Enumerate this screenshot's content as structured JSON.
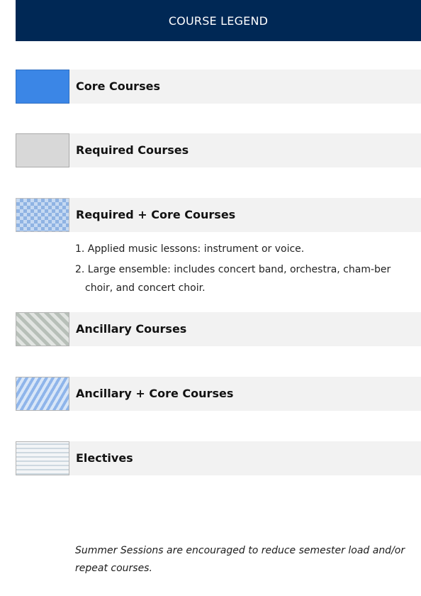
{
  "header": {
    "title": "COURSE LEGEND"
  },
  "legend": [
    {
      "label": "Core Courses",
      "pattern": "solid-blue",
      "color": "#3b86e6"
    },
    {
      "label": "Required Courses",
      "pattern": "solid-gray",
      "color": "#d8d8d8"
    },
    {
      "label": "Required + Core Courses",
      "pattern": "blue-checker",
      "color": "#8fb3e3"
    },
    {
      "label": "Ancillary Courses",
      "pattern": "gray-diagonal-stripes",
      "color": "#b7bfb8"
    },
    {
      "label": "Ancillary + Core Courses",
      "pattern": "blue-diagonal-stripes",
      "color": "#8fb5ea"
    },
    {
      "label": "Electives",
      "pattern": "light-horizontal-stripes",
      "color": "#cdd8e0"
    }
  ],
  "notes": [
    "1. Applied music lessons: instrument or voice.",
    "2. Large ensemble: includes concert band, orchestra, cham-ber choir, and concert choir."
  ],
  "footer_note": "Summer Sessions are encouraged to reduce semester load and/or repeat courses.",
  "colors": {
    "header_background": "#002855",
    "row_band": "#f2f2f2"
  }
}
